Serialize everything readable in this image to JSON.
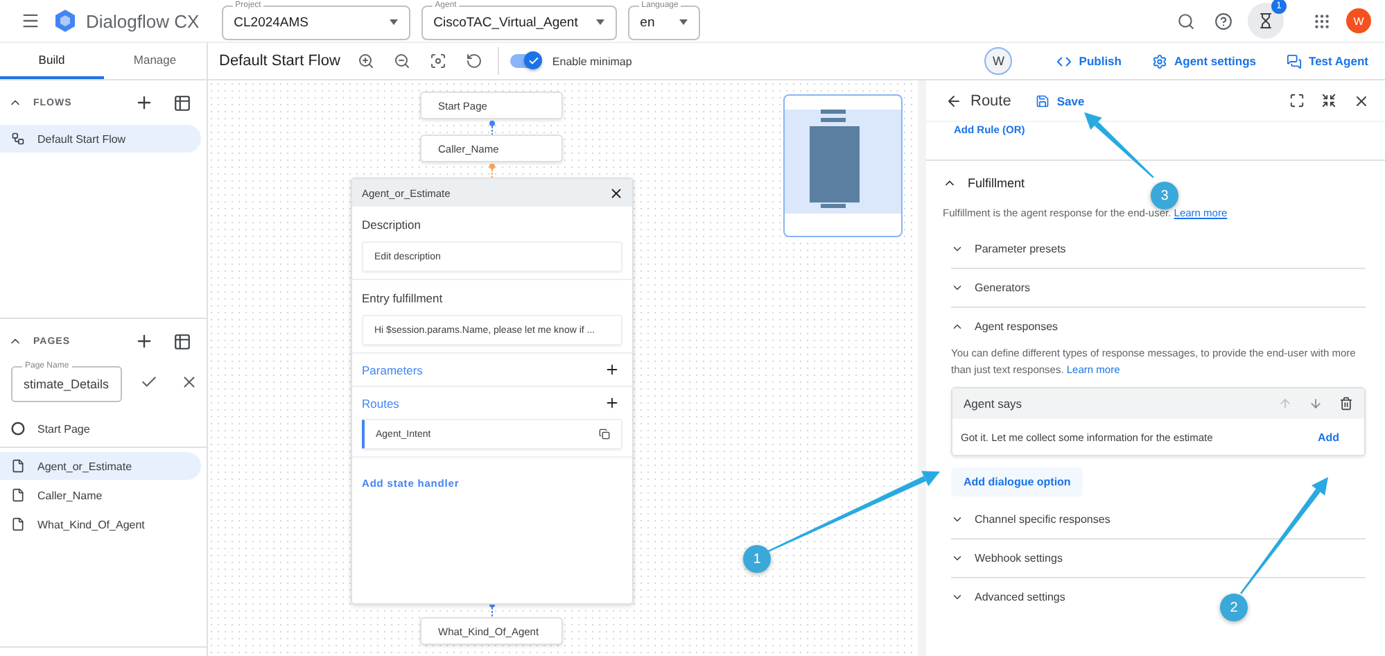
{
  "app": {
    "title": "Dialogflow CX"
  },
  "selectors": [
    {
      "label": "Project",
      "value": "CL2024AMS"
    },
    {
      "label": "Agent",
      "value": "CiscoTAC_Virtual_Agent"
    },
    {
      "label": "Language",
      "value": "en"
    }
  ],
  "header_icons": {
    "notification_count": "1",
    "avatar": "W"
  },
  "tabs": [
    {
      "label": "Build",
      "selected": true
    },
    {
      "label": "Manage",
      "selected": false
    }
  ],
  "flow_toolbar": {
    "title": "Default Start Flow",
    "minimap": {
      "label": "Enable minimap",
      "on": true
    }
  },
  "collaborator": "W",
  "actions": [
    {
      "label": "Publish",
      "kind": "publish"
    },
    {
      "label": "Agent settings",
      "kind": "settings"
    },
    {
      "label": "Test Agent",
      "kind": "test"
    }
  ],
  "sidebar": {
    "flows": {
      "heading": "FLOWS",
      "expanded": true,
      "items": [
        {
          "label": "Default Start Flow",
          "kind": "flow",
          "selected": true
        }
      ]
    },
    "pages": {
      "heading": "PAGES",
      "expanded": true,
      "page_name_field": {
        "label": "Page Name",
        "value": "stimate_Details"
      },
      "items": [
        {
          "label": "Start Page",
          "kind": "start",
          "selected": false
        },
        {
          "label": "Agent_or_Estimate",
          "kind": "page",
          "selected": true
        },
        {
          "label": "Caller_Name",
          "kind": "page",
          "selected": false
        },
        {
          "label": "What_Kind_Of_Agent",
          "kind": "page",
          "selected": false
        }
      ]
    }
  },
  "canvas": {
    "nodes": [
      {
        "label": "Start Page"
      },
      {
        "label": "Caller_Name"
      },
      {
        "label": "What_Kind_Of_Agent"
      }
    ],
    "page_card": {
      "title": "Agent_or_Estimate",
      "description": {
        "heading": "Description",
        "value": "Edit description"
      },
      "entry_fulfillment": {
        "heading": "Entry fulfillment",
        "value": "Hi $session.params.Name, please let me know if ..."
      },
      "parameters": "Parameters",
      "routes": {
        "heading": "Routes",
        "items": [
          "Agent_Intent"
        ]
      },
      "add_state_handler": "Add state handler"
    }
  },
  "route_panel": {
    "title": "Route",
    "save": "Save",
    "add_rule": "Add Rule (OR)",
    "fulfillment": {
      "heading": "Fulfillment",
      "expanded": true,
      "description": "Fulfillment is the agent response for the end-user.",
      "link": "Learn more",
      "sections": [
        {
          "title": "Parameter presets",
          "expanded": false
        },
        {
          "title": "Generators",
          "expanded": false
        },
        {
          "title": "Agent responses",
          "expanded": true,
          "description": "You can define different types of response messages, to provide the end-user with more than just text responses.",
          "link": "Learn more",
          "response": {
            "title": "Agent says",
            "text": "Got it. Let me collect some information for the estimate",
            "action": "Add"
          },
          "add_option": "Add dialogue option"
        },
        {
          "title": "Channel specific responses",
          "expanded": false
        },
        {
          "title": "Webhook settings",
          "expanded": false
        },
        {
          "title": "Advanced settings",
          "expanded": false
        }
      ]
    }
  },
  "callouts": [
    {
      "label": "1"
    },
    {
      "label": "2"
    },
    {
      "label": "3"
    }
  ]
}
